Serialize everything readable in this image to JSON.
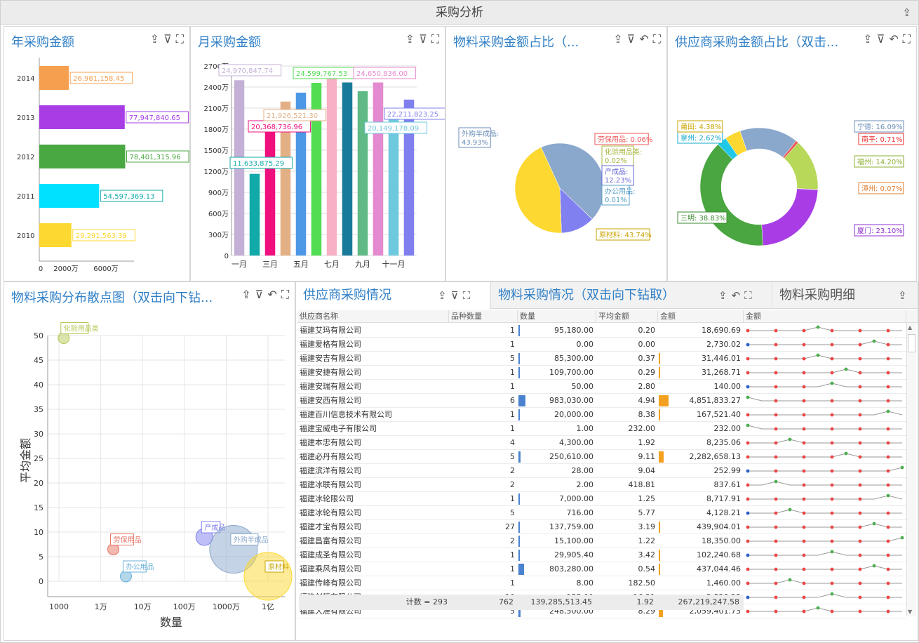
{
  "page": {
    "title": "采购分析"
  },
  "icons": {
    "export": "export-icon",
    "clear_filter": "clear-filter-icon",
    "undo": "undo-icon",
    "fullscreen": "fullscreen-icon"
  },
  "panels": {
    "annual": {
      "title": "年采购金额"
    },
    "monthly": {
      "title": "月采购金额"
    },
    "material_pie": {
      "title": "物料采购金额占比（..."
    },
    "supplier_donut": {
      "title": "供应商采购金额占比（双击..."
    },
    "scatter": {
      "title": "物料采购分布散点图（双击向下钻..."
    }
  },
  "tabs": [
    {
      "label": "供应商采购情况"
    },
    {
      "label": "物料采购情况（双击向下钻取）"
    },
    {
      "label": "物料采购明细"
    }
  ],
  "chart_data": [
    {
      "type": "bar",
      "orientation": "horizontal",
      "categories": [
        "2014",
        "2013",
        "2012",
        "2011",
        "2010"
      ],
      "values": [
        26981158.45,
        77947840.65,
        78401315.96,
        54597369.13,
        29291563.39
      ],
      "labels": [
        "26,981,158.45",
        "77,947,840.65",
        "78,401,315.96",
        "54,597,369.13",
        "29,291,563.39"
      ],
      "colors": [
        "#f4a04f",
        "#a83de6",
        "#49a842",
        "#00e0ff",
        "#fdd830"
      ],
      "xticks": [
        "0",
        "2000万",
        "6000万"
      ],
      "xlim": [
        0,
        80000000
      ]
    },
    {
      "type": "bar",
      "categories": [
        "一月",
        "二月",
        "三月",
        "四月",
        "五月",
        "六月",
        "七月",
        "八月",
        "九月",
        "十月",
        "十一月",
        "十二月"
      ],
      "xticklabels": [
        "一月",
        "",
        "三月",
        "",
        "五月",
        "",
        "七月",
        "",
        "九月",
        "",
        "十一月",
        ""
      ],
      "values": [
        24970847.74,
        11633875.29,
        20368736.96,
        21926521.3,
        23200000,
        24599767.53,
        25400000,
        24650836.0,
        23400000,
        24650836.0,
        20149178.09,
        22211823.25
      ],
      "labels": [
        "24,970,847.74",
        "11,633,875.29",
        "20,368,736.96",
        "21,926,521.30",
        "",
        "24,599,767.53",
        "",
        "",
        "",
        "24,650,836.00",
        "20,149,178.09",
        "22,211,823.25"
      ],
      "colors": [
        "#c4b0d6",
        "#12aaa9",
        "#f0107d",
        "#e3b086",
        "#4d98e6",
        "#52dd52",
        "#f7b0c6",
        "#1a7a99",
        "#5fba86",
        "#e48ad0",
        "#6ec8de",
        "#7f7ff0"
      ],
      "yticks": [
        "0",
        "300万",
        "600万",
        "900万",
        "1200万",
        "1500万",
        "1800万",
        "2100万",
        "2400万",
        "2700万"
      ],
      "ylim": [
        0,
        27000000
      ]
    },
    {
      "type": "pie",
      "slices": [
        {
          "label": "外购半成品",
          "value": 43.93,
          "text": "外购半成品:\n43.93%",
          "color": "#8aa7cc"
        },
        {
          "label": "劳保用品",
          "value": 0.06,
          "text": "劳保用品: 0.06%",
          "color": "#e57363"
        },
        {
          "label": "化验用品类",
          "value": 0.02,
          "text": "化验用品类:\n0.02%",
          "color": "#b7c958"
        },
        {
          "label": "产成品",
          "value": 12.23,
          "text": "产成品:\n12.23%",
          "color": "#8080f0"
        },
        {
          "label": "办公用品",
          "value": 0.01,
          "text": "办公用品:\n0.01%",
          "color": "#6ab0d8"
        },
        {
          "label": "原材料",
          "value": 43.74,
          "text": "原材料: 43.74%",
          "color": "#fdd830"
        }
      ]
    },
    {
      "type": "pie",
      "donut": true,
      "slices": [
        {
          "label": "宁德",
          "value": 16.09,
          "text": "宁德: 16.09%",
          "color": "#8aa7cc"
        },
        {
          "label": "南平",
          "value": 0.71,
          "text": "南平: 0.71%",
          "color": "#e55"
        },
        {
          "label": "福州",
          "value": 14.2,
          "text": "福州: 14.20%",
          "color": "#b7d858"
        },
        {
          "label": "漳州",
          "value": 0.07,
          "text": "漳州: 0.07%",
          "color": "#f0a060"
        },
        {
          "label": "厦门",
          "value": 23.1,
          "text": "厦门: 23.10%",
          "color": "#a83de6"
        },
        {
          "label": "三明",
          "value": 38.83,
          "text": "三明: 38.83%",
          "color": "#4aa640"
        },
        {
          "label": "泉州",
          "value": 2.62,
          "text": "泉州: 2.62%",
          "color": "#20c8e8"
        },
        {
          "label": "莆田",
          "value": 4.38,
          "text": "莆田: 4.38%",
          "color": "#fdd830"
        }
      ]
    },
    {
      "type": "scatter",
      "xlabel": "数量",
      "ylabel": "平均金额",
      "xscale": "log",
      "xticks": [
        "1000",
        "1万",
        "10万",
        "100万",
        "1000万",
        "1亿"
      ],
      "yticks": [
        "0",
        "5",
        "10",
        "15",
        "20",
        "25",
        "30",
        "35",
        "40",
        "45",
        "50"
      ],
      "ylim": [
        0,
        50
      ],
      "points": [
        {
          "label": "化验用品类",
          "x": 1300,
          "y": 49.5,
          "size": 8,
          "color": "#b7c958"
        },
        {
          "label": "劳保用品",
          "x": 20000,
          "y": 6.5,
          "size": 8,
          "color": "#e57363"
        },
        {
          "label": "办公用品",
          "x": 40000,
          "y": 1,
          "size": 8,
          "color": "#6ab0d8"
        },
        {
          "label": "产成品",
          "x": 3000000,
          "y": 9,
          "size": 12,
          "color": "#8080f0"
        },
        {
          "label": "外购半成品",
          "x": 15000000,
          "y": 6.5,
          "size": 34,
          "color": "#8aa7cc"
        },
        {
          "label": "原材料",
          "x": 100000000,
          "y": 1,
          "size": 34,
          "color": "#fdd830"
        }
      ]
    }
  ],
  "table": {
    "columns": [
      "供应商名称",
      "品种数量",
      "数量",
      "平均金额",
      "金额",
      "金额"
    ],
    "rows": [
      [
        "福建艾玛有限公司",
        "1",
        "95,180.00",
        "0.20",
        "18,690.69"
      ],
      [
        "福建爱格有限公司",
        "1",
        "0.00",
        "0.00",
        "2,730.02"
      ],
      [
        "福建安吉有限公司",
        "5",
        "85,300.00",
        "0.37",
        "31,446.01"
      ],
      [
        "福建安捷有限公司",
        "1",
        "109,700.00",
        "0.29",
        "31,268.71"
      ],
      [
        "福建安瑞有限公司",
        "1",
        "50.00",
        "2.80",
        "140.00"
      ],
      [
        "福建安西有限公司",
        "6",
        "983,030.00",
        "4.94",
        "4,851,833.27"
      ],
      [
        "福建百川信息技术有限公司",
        "1",
        "20,000.00",
        "8.38",
        "167,521.40"
      ],
      [
        "福建宝威电子有限公司",
        "1",
        "1.00",
        "232.00",
        "232.00"
      ],
      [
        "福建本忠有限公司",
        "4",
        "4,300.00",
        "1.92",
        "8,235.06"
      ],
      [
        "福建必丹有限公司",
        "5",
        "250,610.00",
        "9.11",
        "2,282,658.13"
      ],
      [
        "福建滨洋有限公司",
        "2",
        "28.00",
        "9.04",
        "252.99"
      ],
      [
        "福建冰联有限公司",
        "2",
        "2.00",
        "418.81",
        "837.61"
      ],
      [
        "福建冰轮限公司",
        "1",
        "7,000.00",
        "1.25",
        "8,717.91"
      ],
      [
        "福建冰轮有限公司",
        "5",
        "716.00",
        "5.77",
        "4,128.21"
      ],
      [
        "福建才宝有限公司",
        "27",
        "137,759.00",
        "3.19",
        "439,904.01"
      ],
      [
        "福建昌富有限公司",
        "2",
        "15,100.00",
        "1.22",
        "18,350.00"
      ],
      [
        "福建成圣有限公司",
        "1",
        "29,905.40",
        "3.42",
        "102,240.68"
      ],
      [
        "福建乘风有限公司",
        "1",
        "803,280.00",
        "0.54",
        "437,044.46"
      ],
      [
        "福建传峰有限公司",
        "1",
        "8.00",
        "182.50",
        "1,460.00"
      ],
      [
        "福建创精有限公司",
        "10",
        "155.00",
        "16.31",
        "2,528.23"
      ],
      [
        "福建大准有限公司",
        "5",
        "248,500.00",
        "8.29",
        "2,059,401.73"
      ]
    ],
    "qty_ratio": [
      0.1,
      0,
      0.09,
      0.11,
      0,
      1.0,
      0.02,
      0,
      0,
      0.25,
      0,
      0,
      0.01,
      0,
      0.14,
      0.02,
      0.03,
      0.82,
      0,
      0,
      0.25
    ],
    "amt_ratio": [
      0,
      0,
      0.01,
      0.01,
      0,
      1.0,
      0.03,
      0,
      0,
      0.47,
      0,
      0,
      0,
      0,
      0.09,
      0,
      0.02,
      0.09,
      0,
      0,
      0.42
    ],
    "spark_peak": [
      5,
      9,
      5,
      7,
      6,
      0,
      10,
      0,
      3,
      7,
      11,
      2,
      10,
      3,
      9,
      11,
      6,
      9,
      3,
      6,
      5
    ],
    "footer": {
      "count_label": "计数 = 293",
      "kinds": "762",
      "qty": "139,285,513.45",
      "avg": "1.92",
      "amount": "267,219,247.58"
    }
  }
}
